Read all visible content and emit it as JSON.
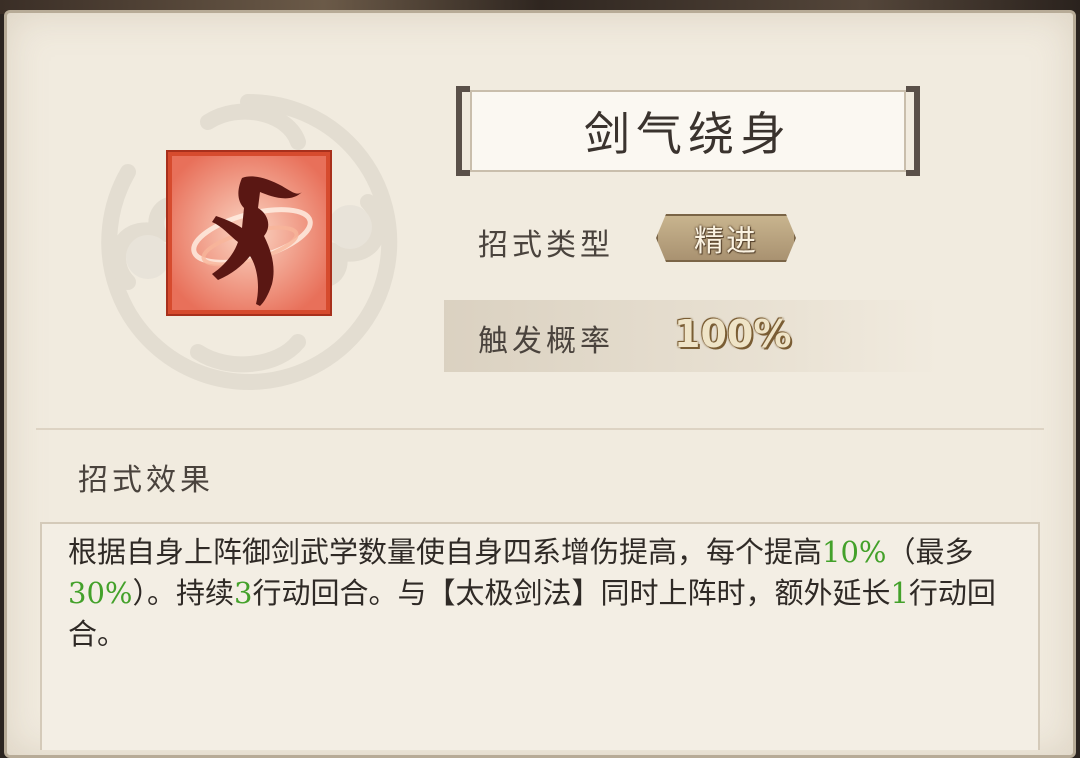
{
  "skill": {
    "name": "剑气绕身",
    "type_label": "招式类型",
    "type_value": "精进",
    "rate_label": "触发概率",
    "rate_value": "100%"
  },
  "effect": {
    "heading": "招式效果",
    "segments": [
      {
        "text": "根据自身上阵御剑武学数量使自身四系增伤提高，每个提高",
        "color": "normal"
      },
      {
        "text": "10%",
        "color": "green"
      },
      {
        "text": "（最多",
        "color": "normal"
      },
      {
        "text": "30%",
        "color": "green"
      },
      {
        "text": "）。持续",
        "color": "normal"
      },
      {
        "text": "3",
        "color": "green"
      },
      {
        "text": "行动回合。与【太极剑法】同时上阵时，额外延长",
        "color": "normal"
      },
      {
        "text": "1",
        "color": "green"
      },
      {
        "text": "行动回合。",
        "color": "normal"
      }
    ]
  },
  "colors": {
    "highlight": "#43a12a",
    "icon_frame": "#d64b2e",
    "panel_bg": "#f1ebdf"
  },
  "icons": {
    "skill_icon": "sword-dancer-icon",
    "emblem": "cloud-emblem-icon"
  }
}
